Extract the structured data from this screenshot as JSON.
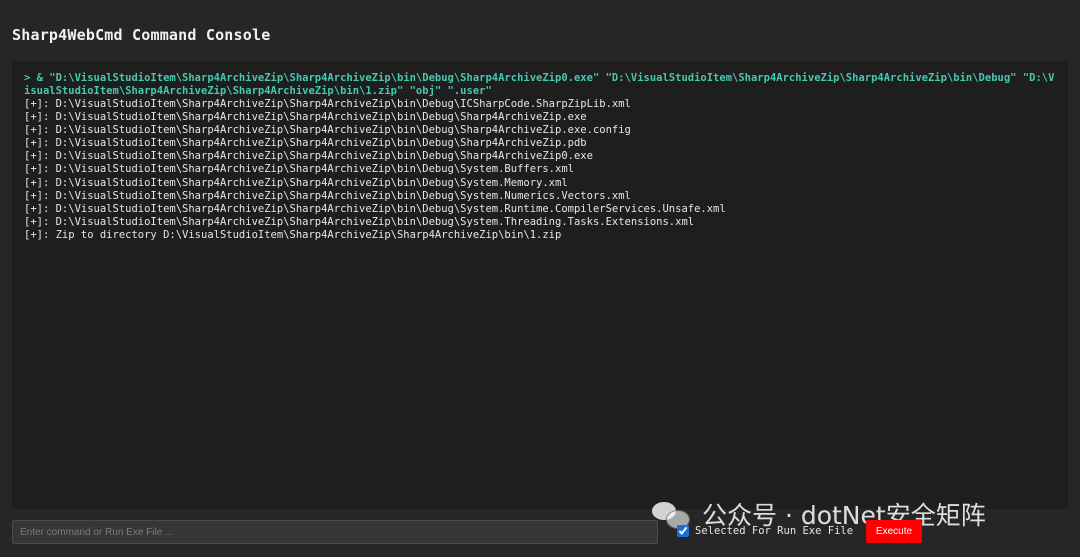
{
  "app": {
    "title": "Sharp4WebCmd Command Console"
  },
  "console": {
    "command": "> & \"D:\\VisualStudioItem\\Sharp4ArchiveZip\\Sharp4ArchiveZip\\bin\\Debug\\Sharp4ArchiveZip0.exe\" \"D:\\VisualStudioItem\\Sharp4ArchiveZip\\Sharp4ArchiveZip\\bin\\Debug\" \"D:\\VisualStudioItem\\Sharp4ArchiveZip\\Sharp4ArchiveZip\\bin\\1.zip\" \"obj\" \".user\"",
    "output_lines": [
      "[+]: D:\\VisualStudioItem\\Sharp4ArchiveZip\\Sharp4ArchiveZip\\bin\\Debug\\ICSharpCode.SharpZipLib.xml",
      "[+]: D:\\VisualStudioItem\\Sharp4ArchiveZip\\Sharp4ArchiveZip\\bin\\Debug\\Sharp4ArchiveZip.exe",
      "[+]: D:\\VisualStudioItem\\Sharp4ArchiveZip\\Sharp4ArchiveZip\\bin\\Debug\\Sharp4ArchiveZip.exe.config",
      "[+]: D:\\VisualStudioItem\\Sharp4ArchiveZip\\Sharp4ArchiveZip\\bin\\Debug\\Sharp4ArchiveZip.pdb",
      "[+]: D:\\VisualStudioItem\\Sharp4ArchiveZip\\Sharp4ArchiveZip\\bin\\Debug\\Sharp4ArchiveZip0.exe",
      "[+]: D:\\VisualStudioItem\\Sharp4ArchiveZip\\Sharp4ArchiveZip\\bin\\Debug\\System.Buffers.xml",
      "[+]: D:\\VisualStudioItem\\Sharp4ArchiveZip\\Sharp4ArchiveZip\\bin\\Debug\\System.Memory.xml",
      "[+]: D:\\VisualStudioItem\\Sharp4ArchiveZip\\Sharp4ArchiveZip\\bin\\Debug\\System.Numerics.Vectors.xml",
      "[+]: D:\\VisualStudioItem\\Sharp4ArchiveZip\\Sharp4ArchiveZip\\bin\\Debug\\System.Runtime.CompilerServices.Unsafe.xml",
      "[+]: D:\\VisualStudioItem\\Sharp4ArchiveZip\\Sharp4ArchiveZip\\bin\\Debug\\System.Threading.Tasks.Extensions.xml",
      "[+]: Zip to directory D:\\VisualStudioItem\\Sharp4ArchiveZip\\Sharp4ArchiveZip\\bin\\1.zip"
    ]
  },
  "input": {
    "placeholder": "Enter command or Run Exe File ...",
    "value": ""
  },
  "run_exe": {
    "label": "Selected For Run Exe File",
    "checked": true
  },
  "execute": {
    "label": "Execute"
  },
  "watermark": {
    "text": "公众号 · dotNet安全矩阵",
    "icon": "wechat-icon"
  },
  "colors": {
    "background": "#262626",
    "console_bg": "#1e1e1e",
    "command_text": "#45c9b0",
    "output_text": "#e6e6e6",
    "execute_button": "#ff0000"
  }
}
